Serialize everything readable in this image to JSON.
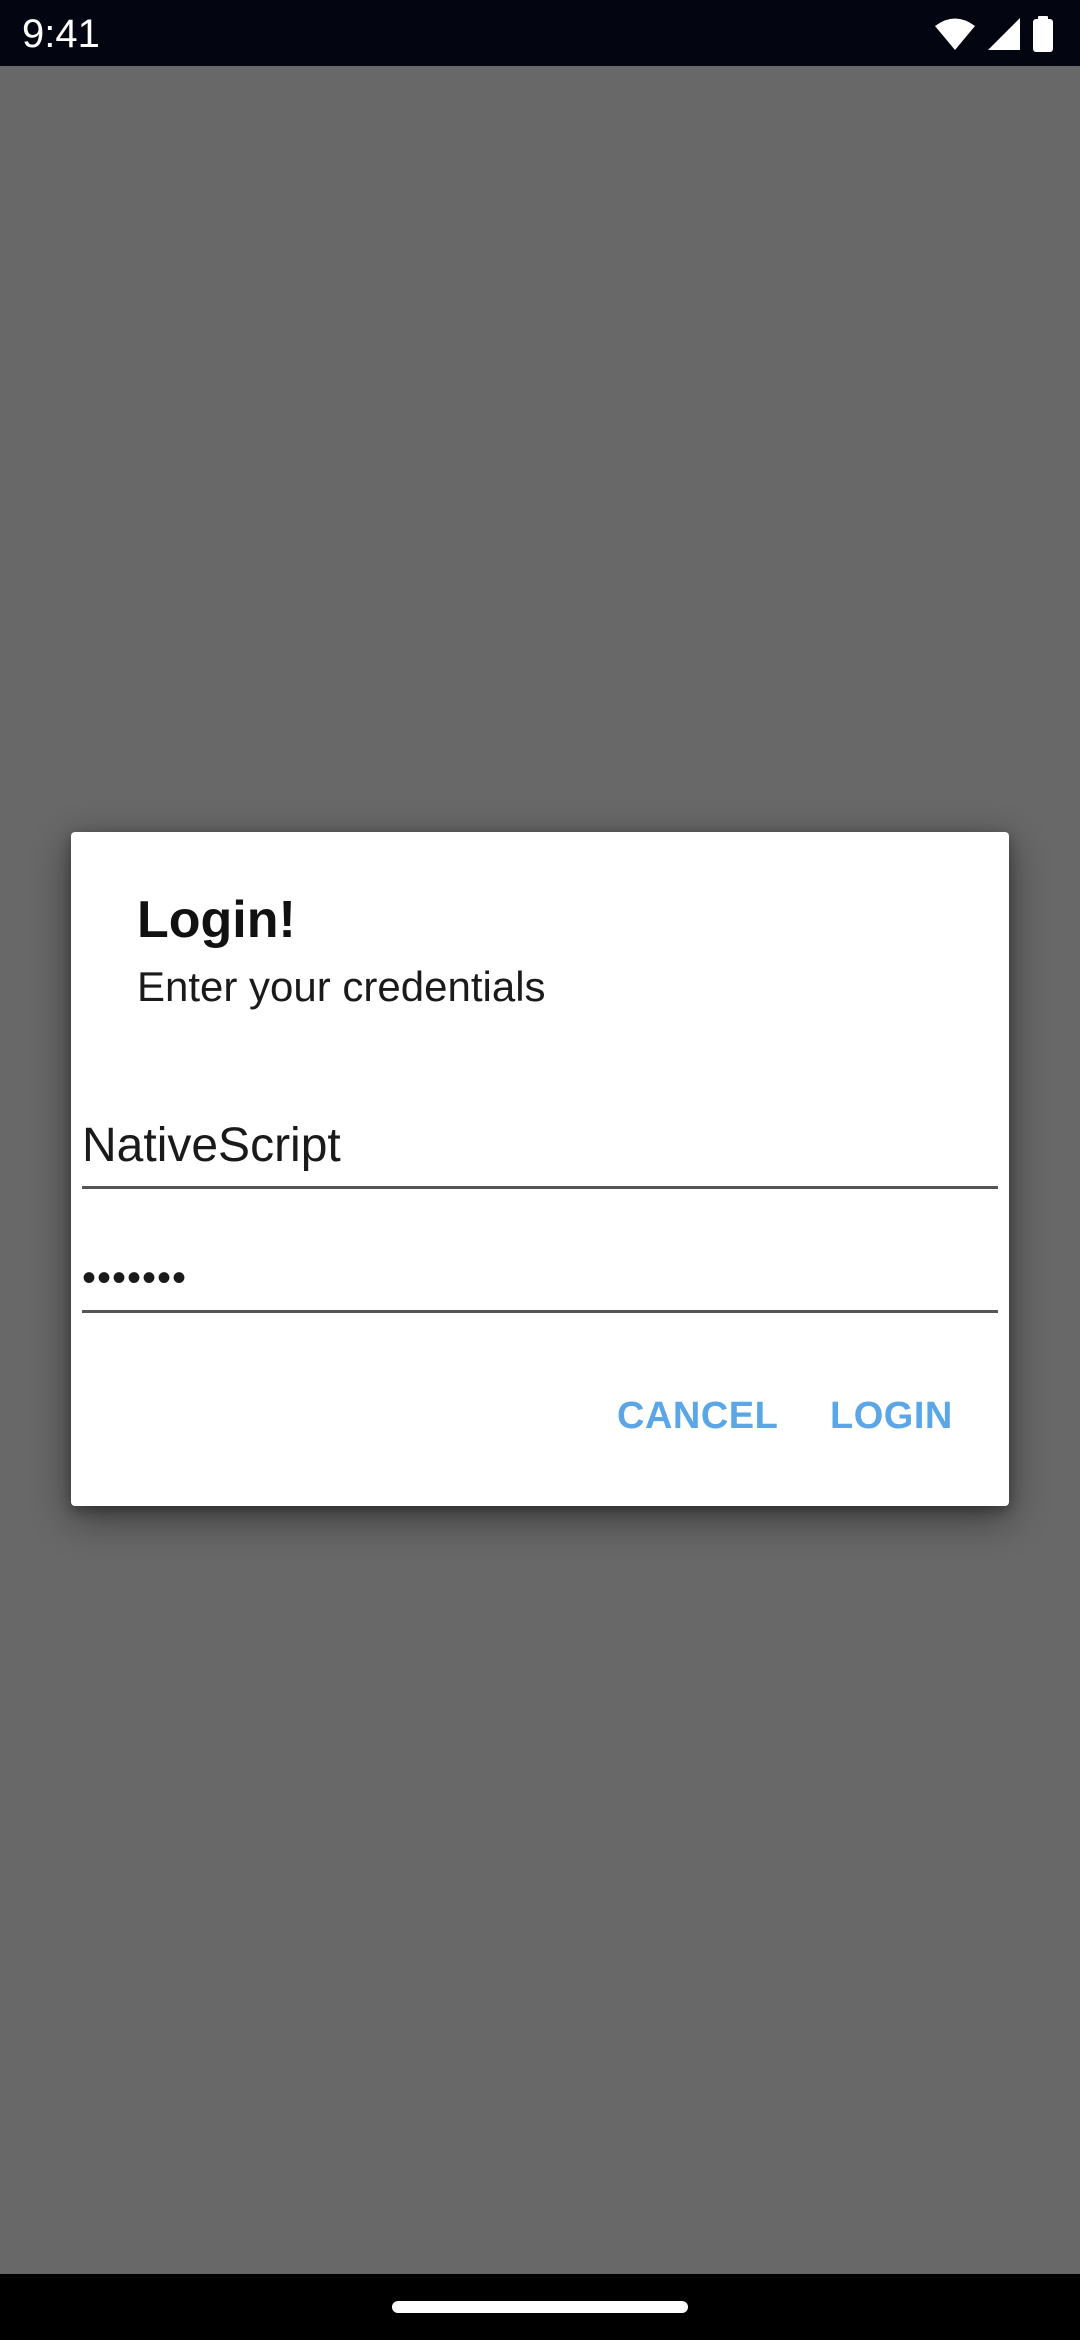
{
  "status_bar": {
    "time": "9:41",
    "icons": [
      "wifi-icon",
      "signal-icon",
      "battery-icon"
    ]
  },
  "dialog": {
    "title": "Login!",
    "message": "Enter your credentials",
    "username_value": "NativeScript",
    "password_masked": "•••••••",
    "cancel_label": "CANCEL",
    "login_label": "LOGIN"
  },
  "colors": {
    "scrim": "#686868",
    "status_bar_bg": "#030510",
    "button_text": "#5aa6e6",
    "dialog_bg": "#ffffff"
  }
}
